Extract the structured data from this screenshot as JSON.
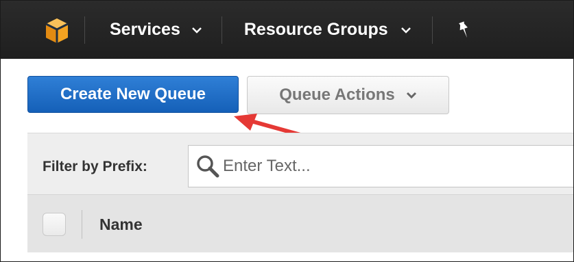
{
  "nav": {
    "logo_icon": "aws-cube-icon",
    "services_label": "Services",
    "resource_groups_label": "Resource Groups",
    "pin_icon": "pin-icon",
    "caret_icon": "chevron-down-icon"
  },
  "toolbar": {
    "create_label": "Create New Queue",
    "actions_label": "Queue Actions"
  },
  "filter": {
    "label": "Filter by Prefix:",
    "placeholder": "Enter Text...",
    "value": ""
  },
  "table": {
    "columns": [
      "Name"
    ]
  },
  "colors": {
    "topbar": "#232f3e",
    "logo_orange": "#f5a623",
    "primary_button": "#1f6fcb",
    "annotation_arrow": "#e53935"
  }
}
